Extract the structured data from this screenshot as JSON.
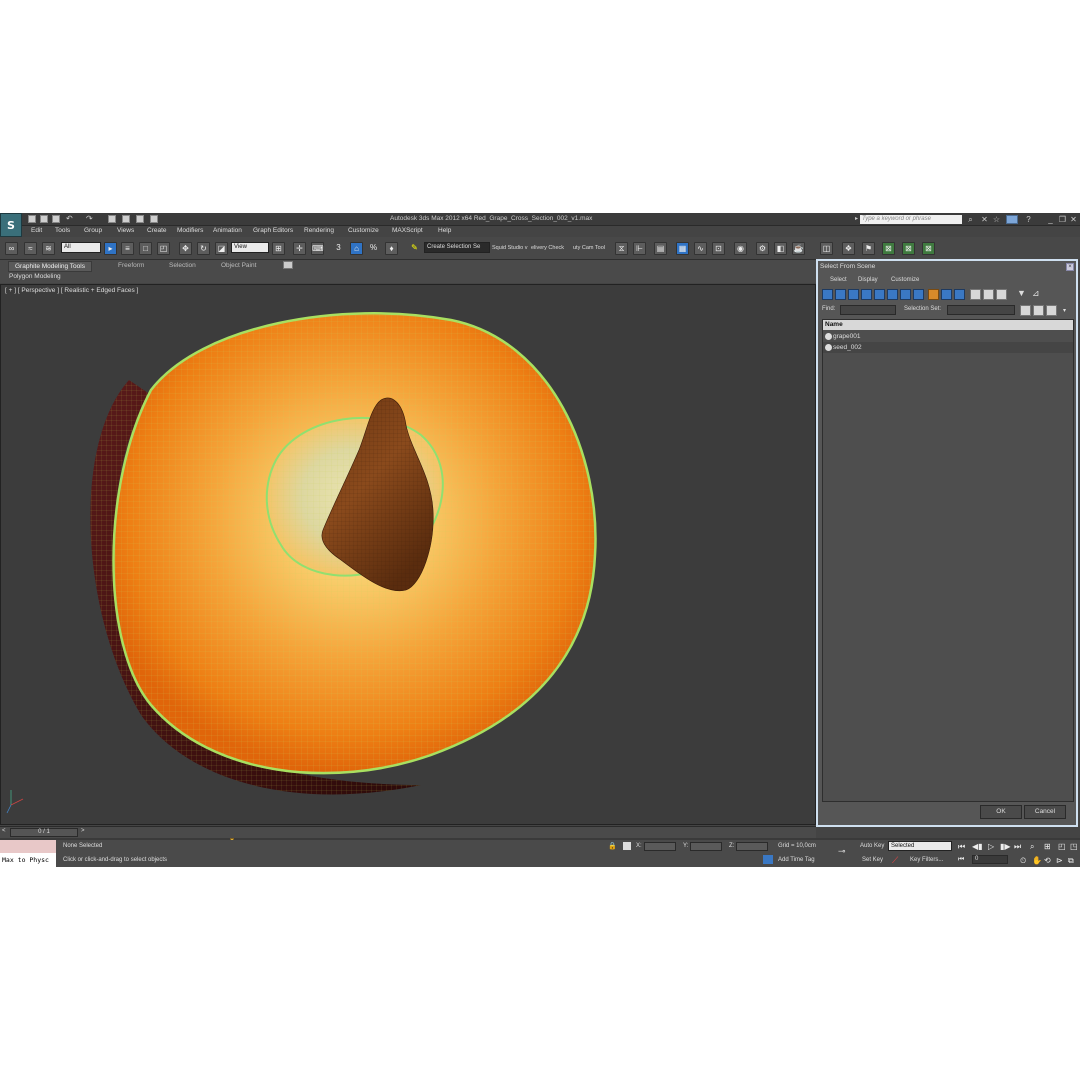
{
  "window": {
    "title": "Autodesk 3ds Max  2012 x64      Red_Grape_Cross_Section_002_v1.max",
    "search_placeholder": "Type a keyword or phrase",
    "app_icon_glyph": "S"
  },
  "menu": [
    "Edit",
    "Tools",
    "Group",
    "Views",
    "Create",
    "Modifiers",
    "Animation",
    "Graph Editors",
    "Rendering",
    "Customize",
    "MAXScript",
    "Help"
  ],
  "toolbar": {
    "selection_filter": "All",
    "reference_coord": "View",
    "named_selection": "Create Selection Se",
    "plugin_label_1": "Squid Studio v",
    "plugin_label_2": "elivery Check",
    "plugin_label_3": "uty Cam Tool",
    "snap_label": "3",
    "angle_snap": "%"
  },
  "ribbon": {
    "tabs": [
      "Graphite Modeling Tools",
      "Freeform",
      "Selection",
      "Object Paint"
    ],
    "active_tab": "Graphite Modeling Tools",
    "panel_label": "Polygon Modeling"
  },
  "viewport": {
    "label": "[ + ] [ Perspective ] [ Realistic + Edged Faces ]"
  },
  "timeline": {
    "frame": "0 / 1",
    "prev": "<",
    "next": ">"
  },
  "status": {
    "selection": "None Selected",
    "prompt": "Click or click-and-drag to select objects",
    "x_label": "X:",
    "y_label": "Y:",
    "z_label": "Z:",
    "grid": "Grid = 10,0cm",
    "add_time_tag": "Add Time Tag",
    "auto_key": "Auto Key",
    "set_key": "Set Key",
    "key_mode": "Selected",
    "key_filters": "Key Filters...",
    "frame_field": "0",
    "maxscript": "Max to Physc"
  },
  "dialog": {
    "title": "Select From Scene",
    "menu": [
      "Select",
      "Display",
      "Customize"
    ],
    "find_label": "Find:",
    "selection_set_label": "Selection Set:",
    "column_header": "Name",
    "items": [
      "grape001",
      "seed_002"
    ],
    "ok": "OK",
    "cancel": "Cancel"
  },
  "colors": {
    "app_bg": "#444444",
    "viewport_bg": "#3c3c3c",
    "accent_blue": "#2f73c5",
    "wire_green": "#9be05a",
    "flesh_orange": "#f08a14",
    "seed_brown": "#7a3a12"
  }
}
